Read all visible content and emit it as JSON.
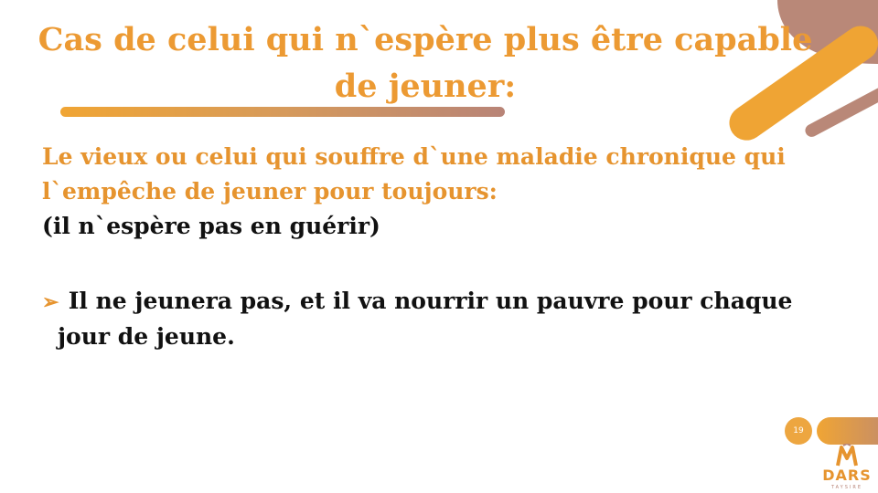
{
  "slide": {
    "title": "Cas de celui qui n`espère plus être capable de jeuner:",
    "intro_line1": "Le vieux ou celui qui souffre d`une maladie chronique qui",
    "intro_line2": "l`empêche de jeuner pour toujours:",
    "intro_note": "(il n`espère pas en guérir)",
    "bullet_line1": "Il ne jeunera pas, et il va nourrir un pauvre pour chaque",
    "bullet_line2": "jour de jeune.",
    "bullet_icon": "arrow-bullet-icon",
    "page_number": "19"
  },
  "branding": {
    "logo_text": "DARS",
    "logo_subtext": "TAYSIRE"
  },
  "colors": {
    "accent_orange": "#e6942f",
    "accent_brown": "#b88477",
    "text": "#111111"
  }
}
